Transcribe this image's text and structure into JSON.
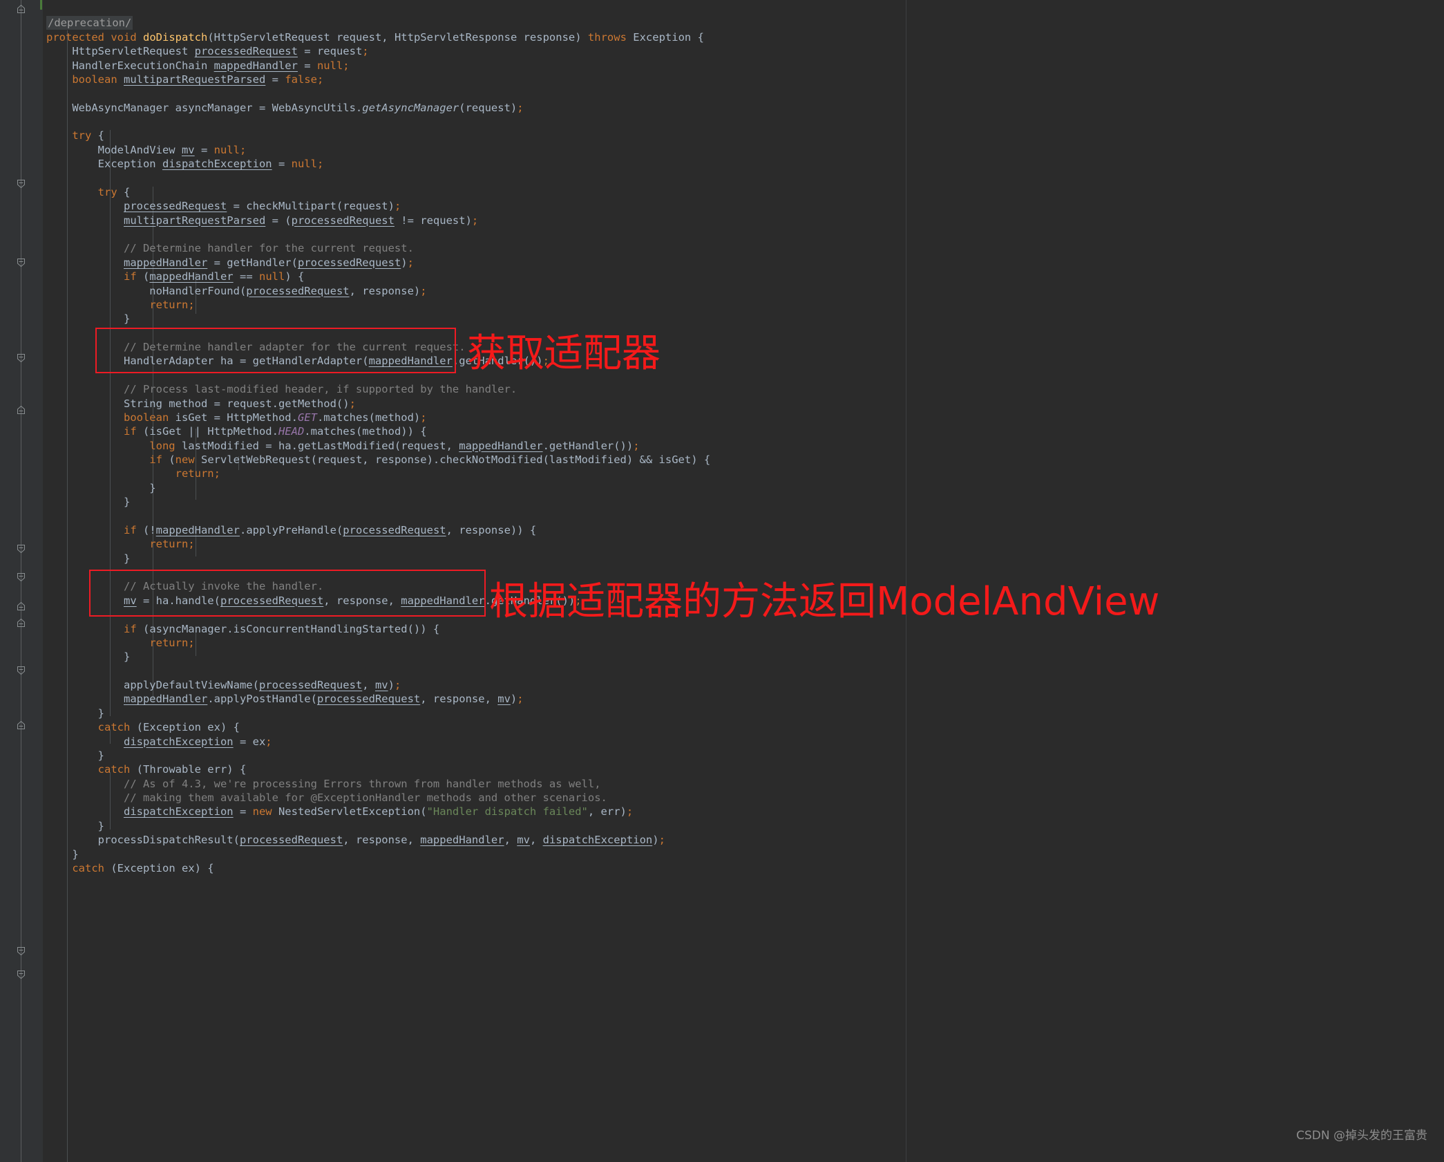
{
  "editor": {
    "inspection_tag": "/deprecation/",
    "language": "java",
    "theme_colors": {
      "background": "#2b2b2b",
      "gutter": "#313335",
      "text": "#a9b7c6",
      "keyword": "#cc7832",
      "comment": "#808080",
      "string": "#6a8759",
      "static_field": "#9876aa",
      "method": "#ffc66d",
      "annotation_red": "#f41a1a"
    }
  },
  "code": {
    "lines": [
      "protected void doDispatch(HttpServletRequest request, HttpServletResponse response) throws Exception {",
      "    HttpServletRequest processedRequest = request;",
      "    HandlerExecutionChain mappedHandler = null;",
      "    boolean multipartRequestParsed = false;",
      "",
      "    WebAsyncManager asyncManager = WebAsyncUtils.getAsyncManager(request);",
      "",
      "    try {",
      "        ModelAndView mv = null;",
      "        Exception dispatchException = null;",
      "",
      "        try {",
      "            processedRequest = checkMultipart(request);",
      "            multipartRequestParsed = (processedRequest != request);",
      "",
      "            // Determine handler for the current request.",
      "            mappedHandler = getHandler(processedRequest);",
      "            if (mappedHandler == null) {",
      "                noHandlerFound(processedRequest, response);",
      "                return;",
      "            }",
      "",
      "            // Determine handler adapter for the current request.",
      "            HandlerAdapter ha = getHandlerAdapter(mappedHandler.getHandler());",
      "",
      "            // Process last-modified header, if supported by the handler.",
      "            String method = request.getMethod();",
      "            boolean isGet = HttpMethod.GET.matches(method);",
      "            if (isGet || HttpMethod.HEAD.matches(method)) {",
      "                long lastModified = ha.getLastModified(request, mappedHandler.getHandler());",
      "                if (new ServletWebRequest(request, response).checkNotModified(lastModified) && isGet) {",
      "                    return;",
      "                }",
      "            }",
      "",
      "            if (!mappedHandler.applyPreHandle(processedRequest, response)) {",
      "                return;",
      "            }",
      "",
      "            // Actually invoke the handler.",
      "            mv = ha.handle(processedRequest, response, mappedHandler.getHandler());",
      "",
      "            if (asyncManager.isConcurrentHandlingStarted()) {",
      "                return;",
      "            }",
      "",
      "            applyDefaultViewName(processedRequest, mv);",
      "            mappedHandler.applyPostHandle(processedRequest, response, mv);",
      "        }",
      "        catch (Exception ex) {",
      "            dispatchException = ex;",
      "        }",
      "        catch (Throwable err) {",
      "            // As of 4.3, we're processing Errors thrown from handler methods as well,",
      "            // making them available for @ExceptionHandler methods and other scenarios.",
      "            dispatchException = new NestedServletException(\"Handler dispatch failed\", err);",
      "        }",
      "        processDispatchResult(processedRequest, response, mappedHandler, mv, dispatchException);",
      "    }",
      "    catch (Exception ex) {"
    ]
  },
  "annotations": [
    {
      "id": "anno-1",
      "label": "获取适配器",
      "box_target": "// Determine handler adapter for the current request. / HandlerAdapter ha = getHandlerAdapter(mappedHandler.getHandler());"
    },
    {
      "id": "anno-2",
      "label": "根据适配器的方法返回ModelAndView",
      "box_target": "// Actually invoke the handler. / mv = ha.handle(processedRequest, response, mappedHandler.getHandler());"
    }
  ],
  "watermark": {
    "text": "CSDN @掉头发的王富贵"
  }
}
